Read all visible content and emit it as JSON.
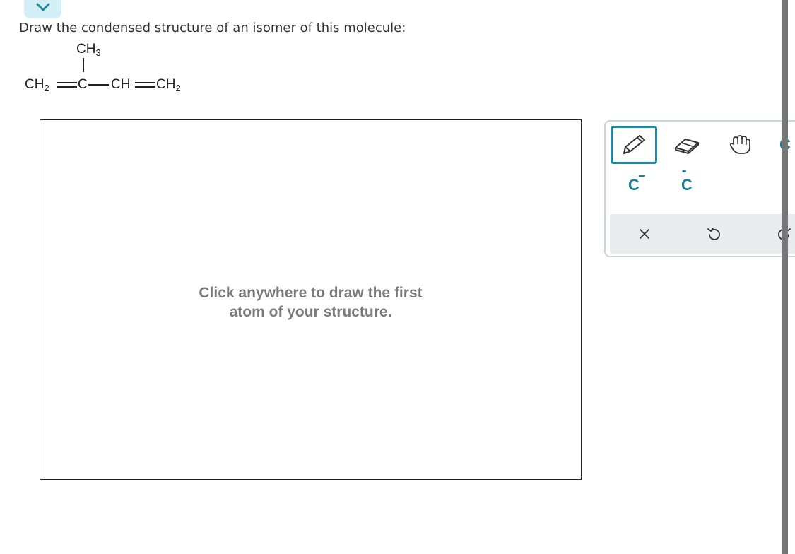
{
  "question": {
    "prompt": "Draw the condensed structure of an isomer of this molecule:"
  },
  "molecule": {
    "branch_atom": "CH",
    "branch_sub": "3",
    "atom1": "CH",
    "atom1_sub": "2",
    "atom2": "C",
    "atom3": "CH",
    "atom4": "CH",
    "atom4_sub": "2"
  },
  "canvas": {
    "hint_line1": "Click anywhere to draw the first",
    "hint_line2": "atom of your structure."
  },
  "toolbar": {
    "tools": [
      "pencil-icon",
      "eraser-icon",
      "hand-icon"
    ],
    "charge_label": "C",
    "charge_sign": "−",
    "lone_pair_label": "C",
    "lone_pair_dots": "••",
    "partial_label": "C"
  },
  "colors": {
    "accent": "#1c8aa3",
    "collapse_bg": "#d3eef4",
    "hint_text": "#7a7a7a",
    "action_bar_bg": "#e8eced"
  }
}
